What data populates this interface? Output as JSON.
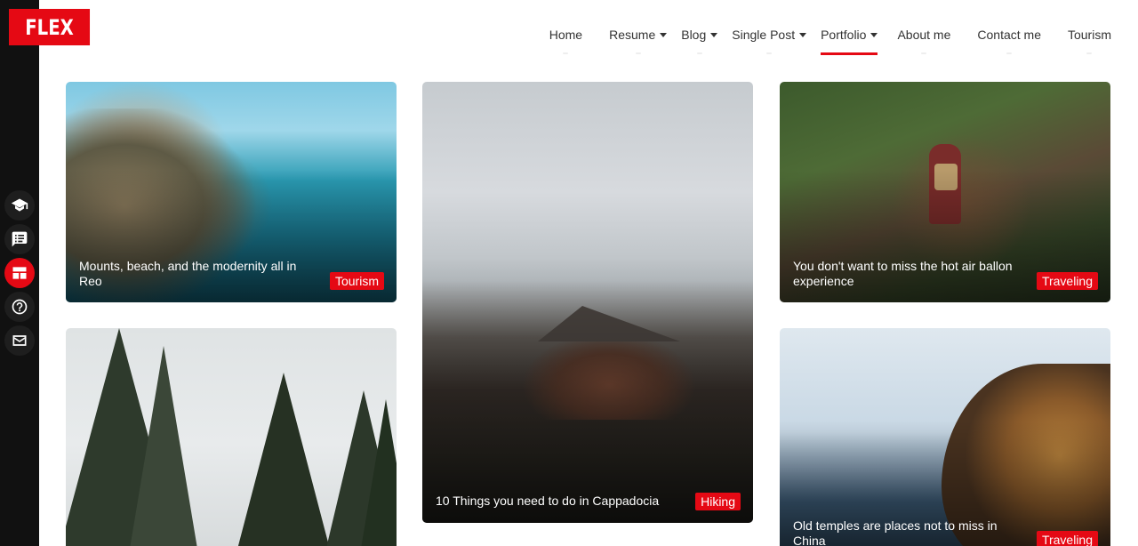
{
  "brand": {
    "logo_text": "FLEX",
    "accent": "#e50914"
  },
  "nav": {
    "items": [
      {
        "label": "Home",
        "dropdown": false,
        "active": false
      },
      {
        "label": "Resume",
        "dropdown": true,
        "active": false
      },
      {
        "label": "Blog",
        "dropdown": true,
        "active": false
      },
      {
        "label": "Single Post",
        "dropdown": true,
        "active": false
      },
      {
        "label": "Portfolio",
        "dropdown": true,
        "active": true
      },
      {
        "label": "About me",
        "dropdown": false,
        "active": false
      },
      {
        "label": "Contact me",
        "dropdown": false,
        "active": false
      },
      {
        "label": "Tourism",
        "dropdown": false,
        "active": false
      }
    ]
  },
  "sidebar": {
    "icons": [
      {
        "name": "graduation-cap-icon",
        "active": false
      },
      {
        "name": "blog-icon",
        "active": false
      },
      {
        "name": "portfolio-icon",
        "active": true
      },
      {
        "name": "help-icon",
        "active": false
      },
      {
        "name": "mail-icon",
        "active": false
      }
    ]
  },
  "cards": [
    {
      "title": "Mounts, beach, and the modernity all in Reo",
      "tag": "Tourism"
    },
    {
      "title": "10 Things you need to do in Cappadocia",
      "tag": "Hiking"
    },
    {
      "title": "You don't want to miss the hot air ballon experience",
      "tag": "Traveling"
    },
    {
      "title": "",
      "tag": ""
    },
    {
      "title": "Old temples are places not to miss in China",
      "tag": "Traveling"
    }
  ]
}
